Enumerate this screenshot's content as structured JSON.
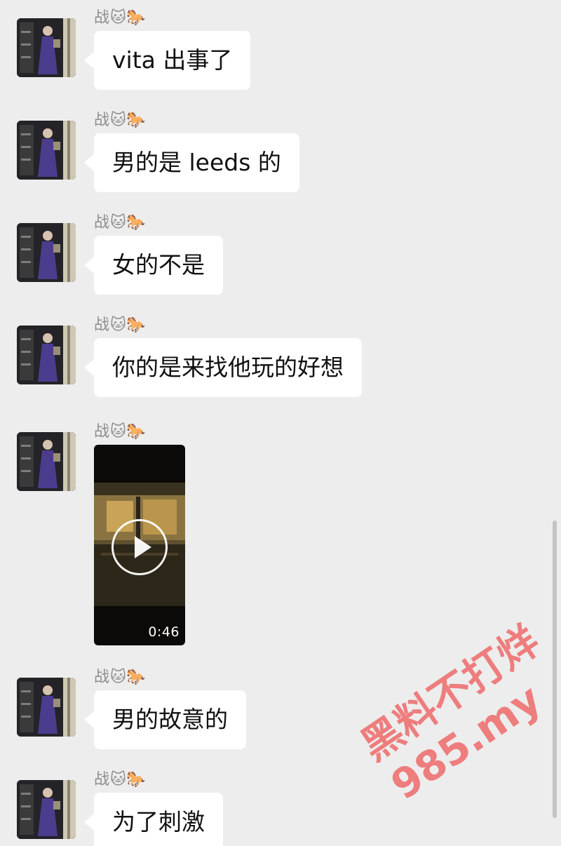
{
  "sender": {
    "name": "战",
    "emoji": "🐱🐎"
  },
  "messages": [
    {
      "type": "text",
      "text": "vita 出事了"
    },
    {
      "type": "text",
      "text": "男的是 leeds 的"
    },
    {
      "type": "text",
      "text": "女的不是"
    },
    {
      "type": "text",
      "text": "你的是来找他玩的好想"
    },
    {
      "type": "video",
      "duration": "0:46"
    },
    {
      "type": "text",
      "text": "男的故意的"
    },
    {
      "type": "text",
      "text": "为了刺激"
    }
  ],
  "watermark": {
    "line1": "黑料不打烊",
    "line2": "985.my"
  }
}
